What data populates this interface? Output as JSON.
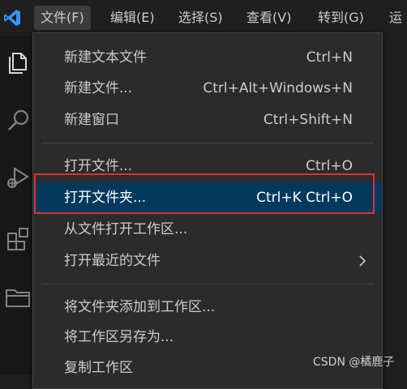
{
  "menubar": {
    "items": [
      {
        "label": "文件(F)"
      },
      {
        "label": "编辑(E)"
      },
      {
        "label": "选择(S)"
      },
      {
        "label": "查看(V)"
      },
      {
        "label": "转到(G)"
      },
      {
        "label": "运"
      }
    ],
    "active_index": 0
  },
  "file_menu": {
    "groups": [
      [
        {
          "label": "新建文本文件",
          "shortcut": "Ctrl+N"
        },
        {
          "label": "新建文件...",
          "shortcut": "Ctrl+Alt+Windows+N"
        },
        {
          "label": "新建窗口",
          "shortcut": "Ctrl+Shift+N"
        }
      ],
      [
        {
          "label": "打开文件...",
          "shortcut": "Ctrl+O"
        },
        {
          "label": "打开文件夹...",
          "shortcut": "Ctrl+K Ctrl+O",
          "selected": true
        },
        {
          "label": "从文件打开工作区...",
          "shortcut": ""
        },
        {
          "label": "打开最近的文件",
          "shortcut": "",
          "submenu_icon": "chevron-right-icon"
        }
      ],
      [
        {
          "label": "将文件夹添加到工作区...",
          "shortcut": ""
        },
        {
          "label": "将工作区另存为...",
          "shortcut": ""
        },
        {
          "label": "复制工作区",
          "shortcut": ""
        }
      ]
    ]
  },
  "activitybar": {
    "icons": [
      "explorer-icon",
      "search-icon",
      "run-debug-icon",
      "extensions-icon",
      "folder-icon"
    ]
  },
  "colors": {
    "accent": "#04395e",
    "highlight": "#e03030",
    "logo": "#3794ff"
  },
  "watermark": {
    "text": "CSDN @橘鹿子"
  }
}
